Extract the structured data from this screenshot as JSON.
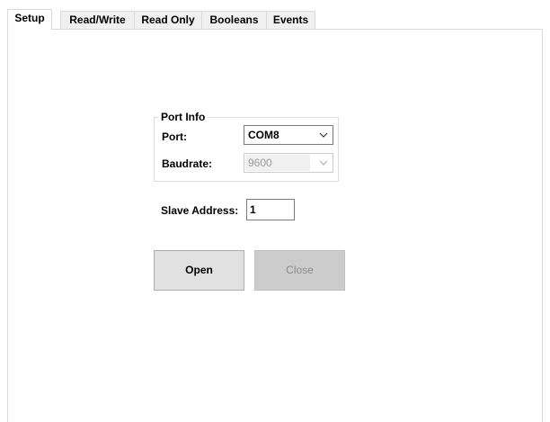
{
  "tabs": [
    {
      "label": "Setup",
      "active": true
    },
    {
      "label": "Read/Write",
      "active": false
    },
    {
      "label": "Read Only",
      "active": false
    },
    {
      "label": "Booleans",
      "active": false
    },
    {
      "label": "Events",
      "active": false
    }
  ],
  "port_info": {
    "legend": "Port Info",
    "port_label": "Port:",
    "port_value": "COM8",
    "baudrate_label": "Baudrate:",
    "baudrate_value": "9600"
  },
  "slave": {
    "label": "Slave Address:",
    "value": "1"
  },
  "buttons": {
    "open_label": "Open",
    "close_label": "Close"
  },
  "icons": {
    "port_dropdown": "chevron-down-icon",
    "baudrate_dropdown": "chevron-down-icon"
  },
  "colors": {
    "tab_inactive_bg": "#f0f0f0",
    "button_bg": "#e1e1e1",
    "button_disabled_bg": "#cccccc"
  }
}
